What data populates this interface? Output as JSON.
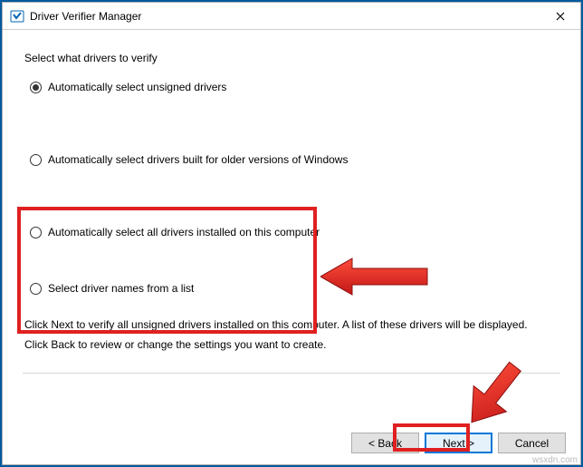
{
  "window": {
    "title": "Driver Verifier Manager"
  },
  "heading": "Select what drivers to verify",
  "options": {
    "auto_unsigned": "Automatically select unsigned drivers",
    "auto_older": "Automatically select drivers built for older versions of Windows",
    "auto_all": "Automatically select all drivers installed on this computer",
    "from_list": "Select driver names from a list",
    "selected": "auto_unsigned"
  },
  "hints": {
    "line1": "Click Next to verify all unsigned drivers installed on this computer. A list of these drivers will be displayed.",
    "line2": "Click Back to review or change the settings you want to create."
  },
  "buttons": {
    "back": "< Back",
    "next": "Next >",
    "cancel": "Cancel"
  },
  "watermark": "wsxdn.com"
}
